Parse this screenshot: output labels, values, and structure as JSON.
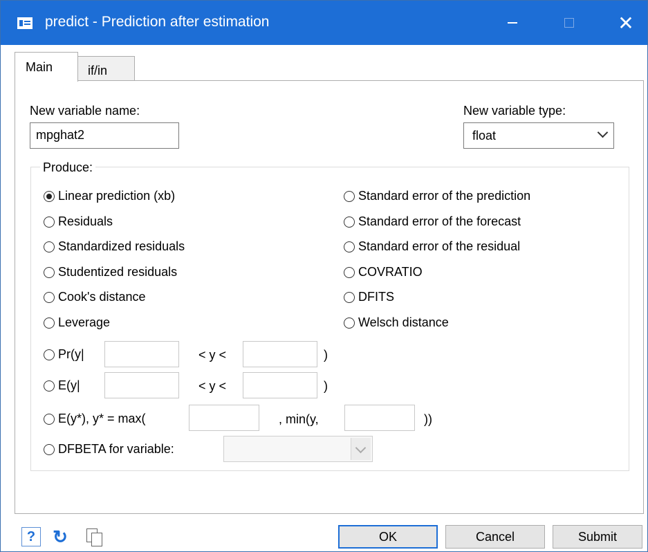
{
  "window": {
    "title": "predict - Prediction after estimation",
    "icons": {
      "app": "dialog-icon",
      "minimize": "minimize-icon",
      "maximize": "maximize-icon",
      "close": "close-icon"
    },
    "close_glyph": "✕",
    "accent_color": "#1d6ed6"
  },
  "tabs": [
    {
      "label": "Main",
      "selected": true
    },
    {
      "label": "if/in",
      "selected": false
    }
  ],
  "main": {
    "new_var_label": "New variable name:",
    "new_var_value": "mpghat2",
    "type_label": "New variable type:",
    "type_value": "float",
    "produce_label": "Produce:",
    "options_left": [
      {
        "label": "Linear prediction (xb)",
        "checked": true
      },
      {
        "label": "Residuals",
        "checked": false
      },
      {
        "label": "Standardized residuals",
        "checked": false
      },
      {
        "label": "Studentized residuals",
        "checked": false
      },
      {
        "label": "Cook's distance",
        "checked": false
      },
      {
        "label": "Leverage",
        "checked": false
      }
    ],
    "options_right": [
      {
        "label": "Standard error of the prediction",
        "checked": false
      },
      {
        "label": "Standard error of the forecast",
        "checked": false
      },
      {
        "label": "Standard error of the residual",
        "checked": false
      },
      {
        "label": "COVRATIO",
        "checked": false
      },
      {
        "label": "DFITS",
        "checked": false
      },
      {
        "label": "Welsch distance",
        "checked": false
      }
    ],
    "pr": {
      "label": "Pr(y|",
      "mid": "< y <",
      "close": ")"
    },
    "ey": {
      "label": "E(y|",
      "mid": "< y <",
      "close": ")"
    },
    "eystar": {
      "label": "E(y*), y* = max(",
      "mid": ", min(y,",
      "close": "))"
    },
    "dfbeta": {
      "label": "DFBETA for variable:"
    }
  },
  "footer": {
    "help_glyph": "?",
    "reset_glyph": "↻",
    "icons": {
      "help": "help-icon",
      "reset": "reset-icon",
      "copy": "copy-command-icon"
    },
    "ok": "OK",
    "cancel": "Cancel",
    "submit": "Submit"
  }
}
